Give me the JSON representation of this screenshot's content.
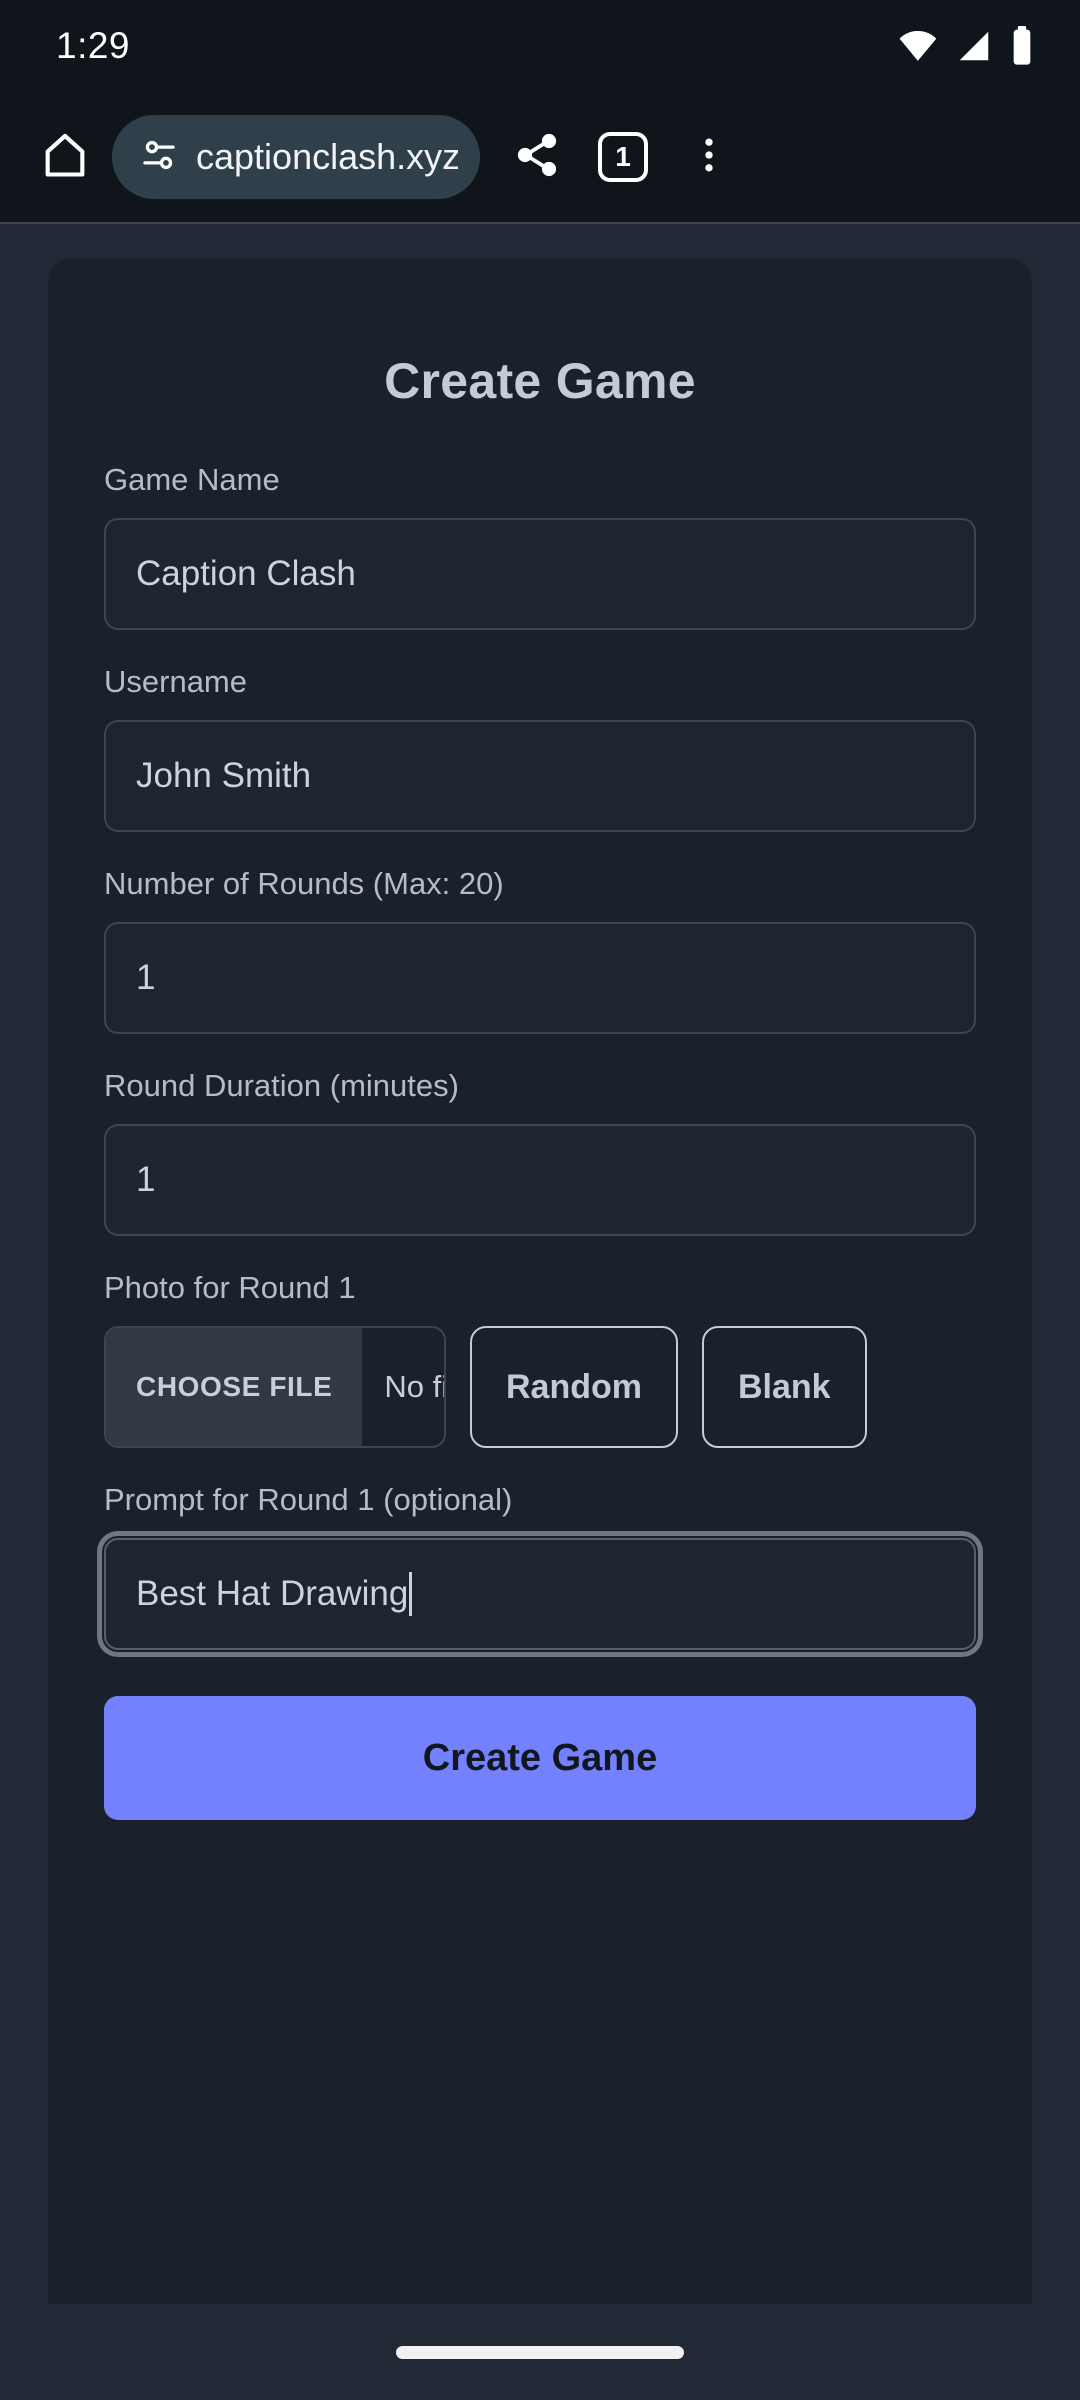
{
  "status_bar": {
    "time": "1:29",
    "icons": [
      "wifi-icon",
      "cellular-signal-icon",
      "battery-icon"
    ]
  },
  "browser": {
    "home_icon": "home-icon",
    "site_settings_icon": "tune-icon",
    "url": "captionclash.xyz/create-",
    "share_icon": "share-icon",
    "tab_count": "1",
    "menu_icon": "more-vertical-icon"
  },
  "page": {
    "title": "Create Game",
    "fields": {
      "game_name": {
        "label": "Game Name",
        "value": "Caption Clash",
        "placeholder": "Game Name"
      },
      "username": {
        "label": "Username",
        "value": "John Smith",
        "placeholder": "Username"
      },
      "rounds": {
        "label": "Number of Rounds (Max: 20)",
        "value": "1",
        "placeholder": "1"
      },
      "duration": {
        "label": "Round Duration (minutes)",
        "value": "1",
        "placeholder": "1"
      },
      "photo": {
        "label": "Photo for Round 1",
        "choose_file_label": "CHOOSE FILE",
        "file_name": "No file chosen",
        "random_label": "Random",
        "blank_label": "Blank"
      },
      "prompt": {
        "label": "Prompt for Round 1 (optional)",
        "value": "Best Hat Drawing",
        "placeholder": "Prompt for Round 1"
      }
    },
    "submit_label": "Create Game"
  },
  "colors": {
    "page_background": "#222936",
    "card_background": "#1b212b",
    "accent_button": "#7382fc",
    "label_text": "#b3bcc8",
    "input_text": "#ccd3dc",
    "border": "#3d4552",
    "omnibox": "#30404a"
  }
}
